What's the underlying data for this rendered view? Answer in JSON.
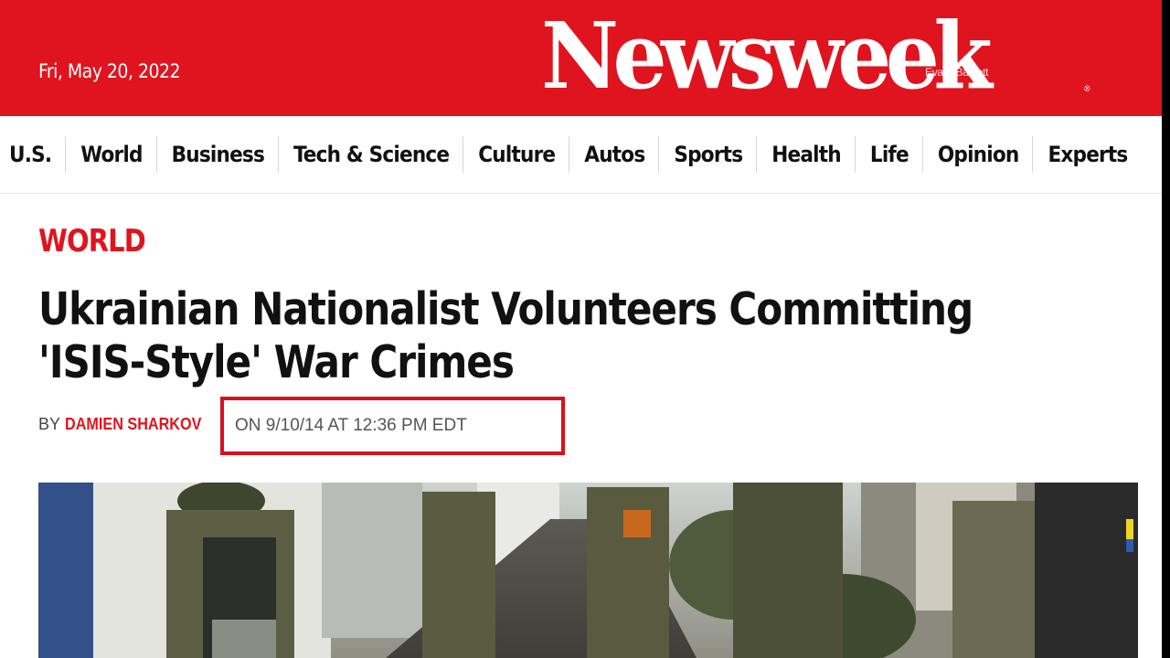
{
  "header": {
    "date": "Fri, May 20, 2022",
    "logo": "Newsweek",
    "registered_mark": "®",
    "watermark": "Eva K Bartlett"
  },
  "nav": {
    "items": [
      "U.S.",
      "World",
      "Business",
      "Tech & Science",
      "Culture",
      "Autos",
      "Sports",
      "Health",
      "Life",
      "Opinion",
      "Experts"
    ]
  },
  "article": {
    "section": "WORLD",
    "headline": "Ukrainian Nationalist Volunteers Committing 'ISIS-Style' War Crimes",
    "byline_prefix": "BY ",
    "author": "DAMIEN SHARKOV",
    "dateline": "ON 9/10/14 AT 12:36 PM EDT"
  },
  "colors": {
    "brand_red": "#e0141e",
    "highlight_red": "#d8101e",
    "text_dark": "#111111"
  }
}
